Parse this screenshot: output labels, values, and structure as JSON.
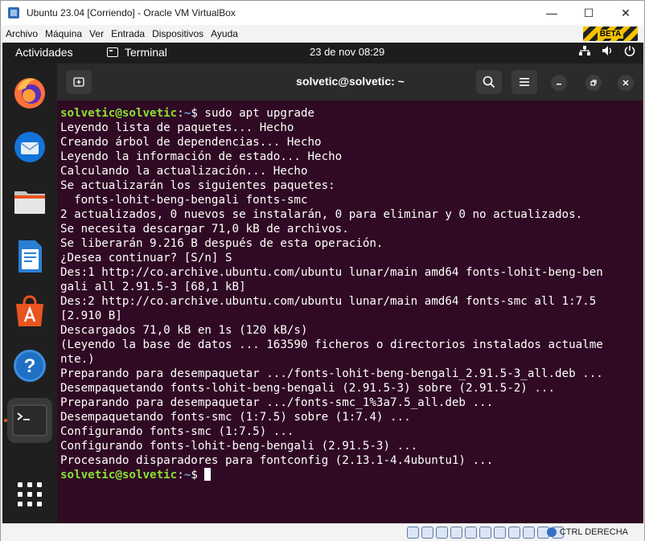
{
  "window": {
    "title": "Ubuntu 23.04 [Corriendo] - Oracle VM VirtualBox",
    "beta_badge": "BETA",
    "minimize": "—",
    "maximize": "☐",
    "close": "✕"
  },
  "menubar": [
    "Archivo",
    "Máquina",
    "Ver",
    "Entrada",
    "Dispositivos",
    "Ayuda"
  ],
  "topbar": {
    "activities": "Actividades",
    "app": "Terminal",
    "clock": "23 de nov  08:29",
    "icons": [
      "network-icon",
      "volume-icon",
      "power-icon"
    ]
  },
  "dock": [
    "firefox-icon",
    "thunderbird-icon",
    "files-icon",
    "writer-icon",
    "app-center-icon",
    "help-icon",
    "terminal-icon",
    "show-apps-icon"
  ],
  "terminal": {
    "title": "solvetic@solvetic: ~",
    "prompt_user": "solvetic@solvetic",
    "prompt_sep": ":",
    "prompt_path": "~",
    "prompt_end": "$ ",
    "command": "sudo apt upgrade",
    "output": [
      "Leyendo lista de paquetes... Hecho",
      "Creando árbol de dependencias... Hecho",
      "Leyendo la información de estado... Hecho",
      "Calculando la actualización... Hecho",
      "Se actualizarán los siguientes paquetes:",
      "  fonts-lohit-beng-bengali fonts-smc",
      "2 actualizados, 0 nuevos se instalarán, 0 para eliminar y 0 no actualizados.",
      "Se necesita descargar 71,0 kB de archivos.",
      "Se liberarán 9.216 B después de esta operación.",
      "¿Desea continuar? [S/n] S",
      "Des:1 http://co.archive.ubuntu.com/ubuntu lunar/main amd64 fonts-lohit-beng-ben",
      "gali all 2.91.5-3 [68,1 kB]",
      "Des:2 http://co.archive.ubuntu.com/ubuntu lunar/main amd64 fonts-smc all 1:7.5",
      "[2.910 B]",
      "Descargados 71,0 kB en 1s (120 kB/s)",
      "(Leyendo la base de datos ... 163590 ficheros o directorios instalados actualme",
      "nte.)",
      "Preparando para desempaquetar .../fonts-lohit-beng-bengali_2.91.5-3_all.deb ...",
      "Desempaquetando fonts-lohit-beng-bengali (2.91.5-3) sobre (2.91.5-2) ...",
      "Preparando para desempaquetar .../fonts-smc_1%3a7.5_all.deb ...",
      "Desempaquetando fonts-smc (1:7.5) sobre (1:7.4) ...",
      "Configurando fonts-smc (1:7.5) ...",
      "Configurando fonts-lohit-beng-bengali (2.91.5-3) ...",
      "Procesando disparadores para fontconfig (2.13.1-4.4ubuntu1) ..."
    ]
  },
  "statusbar": {
    "host_key": "CTRL DERECHA"
  }
}
